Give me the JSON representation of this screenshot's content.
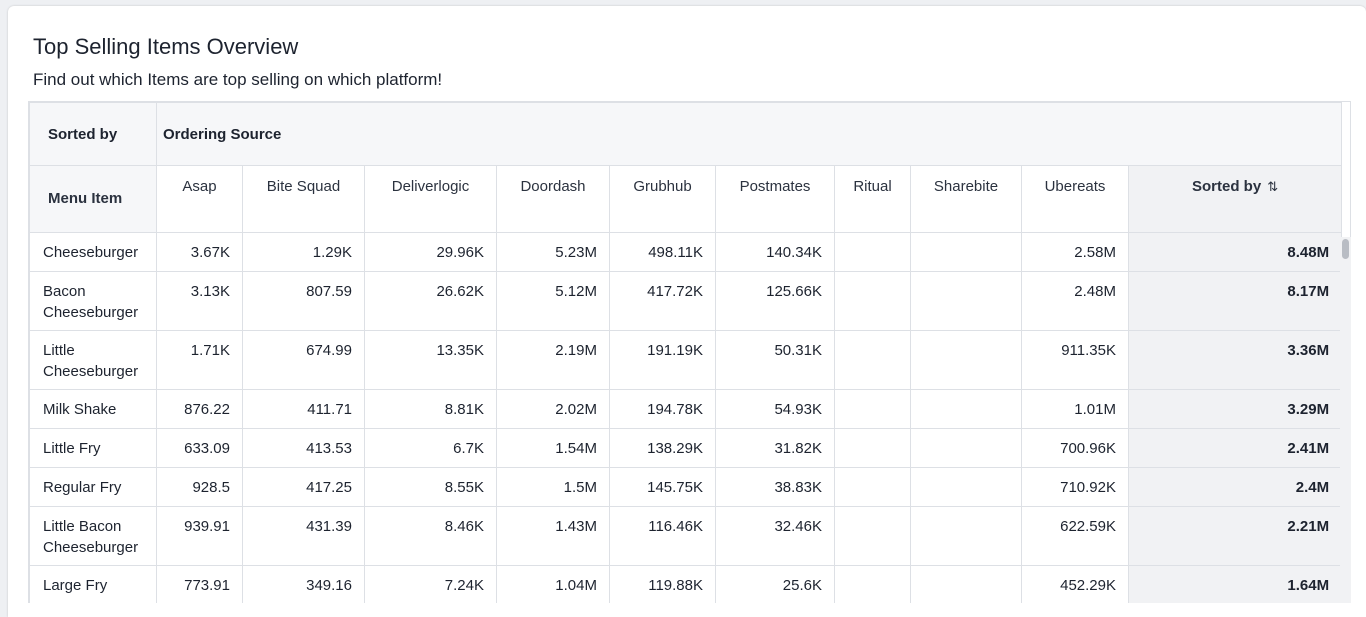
{
  "card": {
    "title": "Top Selling Items Overview",
    "subtitle": "Find out which Items are top selling on which platform!"
  },
  "table": {
    "sorted_by_label": "Sorted by",
    "group_header": "Ordering Source",
    "menu_item_header": "Menu Item",
    "columns": [
      "Asap",
      "Bite Squad",
      "Deliverlogic",
      "Doordash",
      "Grubhub",
      "Postmates",
      "Ritual",
      "Sharebite",
      "Ubereats"
    ],
    "sorted_column_label": "Sorted by",
    "sort_icon": "sort-arrows-icon",
    "rows": [
      {
        "item": "Cheeseburger",
        "values": [
          "3.67K",
          "1.29K",
          "29.96K",
          "5.23M",
          "498.11K",
          "140.34K",
          "",
          "",
          "2.58M"
        ],
        "total": "8.48M"
      },
      {
        "item": "Bacon Cheeseburger",
        "values": [
          "3.13K",
          "807.59",
          "26.62K",
          "5.12M",
          "417.72K",
          "125.66K",
          "",
          "",
          "2.48M"
        ],
        "total": "8.17M"
      },
      {
        "item": "Little Cheeseburger",
        "values": [
          "1.71K",
          "674.99",
          "13.35K",
          "2.19M",
          "191.19K",
          "50.31K",
          "",
          "",
          "911.35K"
        ],
        "total": "3.36M"
      },
      {
        "item": "Milk Shake",
        "values": [
          "876.22",
          "411.71",
          "8.81K",
          "2.02M",
          "194.78K",
          "54.93K",
          "",
          "",
          "1.01M"
        ],
        "total": "3.29M"
      },
      {
        "item": "Little Fry",
        "values": [
          "633.09",
          "413.53",
          "6.7K",
          "1.54M",
          "138.29K",
          "31.82K",
          "",
          "",
          "700.96K"
        ],
        "total": "2.41M"
      },
      {
        "item": "Regular Fry",
        "values": [
          "928.5",
          "417.25",
          "8.55K",
          "1.5M",
          "145.75K",
          "38.83K",
          "",
          "",
          "710.92K"
        ],
        "total": "2.4M"
      },
      {
        "item": "Little Bacon Cheeseburger",
        "values": [
          "939.91",
          "431.39",
          "8.46K",
          "1.43M",
          "116.46K",
          "32.46K",
          "",
          "",
          "622.59K"
        ],
        "total": "2.21M"
      },
      {
        "item": "Large Fry",
        "values": [
          "773.91",
          "349.16",
          "7.24K",
          "1.04M",
          "119.88K",
          "25.6K",
          "",
          "",
          "452.29K"
        ],
        "total": "1.64M"
      }
    ]
  }
}
